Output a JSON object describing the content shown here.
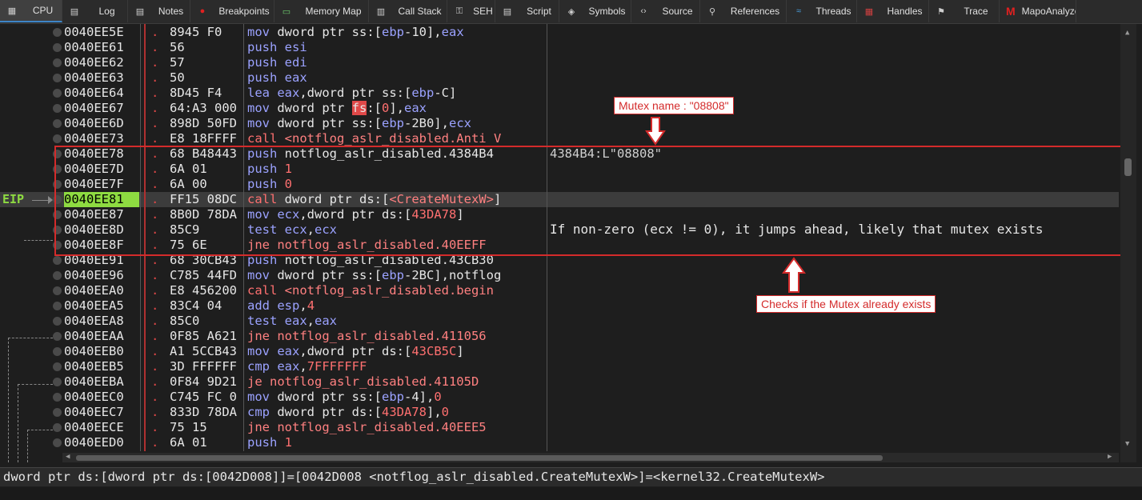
{
  "tabs": [
    {
      "label": "CPU",
      "icon": "cpu-icon",
      "active": true
    },
    {
      "label": "Log",
      "icon": "log-icon"
    },
    {
      "label": "Notes",
      "icon": "notes-icon"
    },
    {
      "label": "Breakpoints",
      "icon": "breakpoint-icon"
    },
    {
      "label": "Memory Map",
      "icon": "memory-map-icon"
    },
    {
      "label": "Call Stack",
      "icon": "call-stack-icon"
    },
    {
      "label": "SEH",
      "icon": "seh-icon"
    },
    {
      "label": "Script",
      "icon": "script-icon"
    },
    {
      "label": "Symbols",
      "icon": "symbols-icon"
    },
    {
      "label": "Source",
      "icon": "source-icon"
    },
    {
      "label": "References",
      "icon": "references-icon"
    },
    {
      "label": "Threads",
      "icon": "threads-icon"
    },
    {
      "label": "Handles",
      "icon": "handles-icon"
    },
    {
      "label": "Trace",
      "icon": "trace-icon"
    },
    {
      "label": "MapoAnalyzer",
      "icon": "mapoanalyzer-icon"
    }
  ],
  "eip_label": "EIP",
  "rows": [
    {
      "addr": "0040EE5E",
      "bytes": "8945 F0",
      "instr": "mov dword ptr ss:[ebp-10],eax",
      "comment": ""
    },
    {
      "addr": "0040EE61",
      "bytes": "56",
      "instr": "push esi",
      "comment": ""
    },
    {
      "addr": "0040EE62",
      "bytes": "57",
      "instr": "push edi",
      "comment": ""
    },
    {
      "addr": "0040EE63",
      "bytes": "50",
      "instr": "push eax",
      "comment": ""
    },
    {
      "addr": "0040EE64",
      "bytes": "8D45 F4",
      "instr": "lea eax,dword ptr ss:[ebp-C]",
      "comment": ""
    },
    {
      "addr": "0040EE67",
      "bytes": "64:A3 000",
      "instr": "mov dword ptr fs:[0],eax",
      "comment": ""
    },
    {
      "addr": "0040EE6D",
      "bytes": "898D 50FD",
      "instr": "mov dword ptr ss:[ebp-2B0],ecx",
      "comment": ""
    },
    {
      "addr": "0040EE73",
      "bytes": "E8 18FFFF",
      "instr": "call <notflog_aslr_disabled.Anti V",
      "comment": ""
    },
    {
      "addr": "0040EE78",
      "bytes": "68 B48443",
      "instr": "push notflog_aslr_disabled.4384B4",
      "comment": "4384B4:L\"08808\""
    },
    {
      "addr": "0040EE7D",
      "bytes": "6A 01",
      "instr": "push 1",
      "comment": ""
    },
    {
      "addr": "0040EE7F",
      "bytes": "6A 00",
      "instr": "push 0",
      "comment": ""
    },
    {
      "addr": "0040EE81",
      "bytes": "FF15 08DC",
      "instr": "call dword ptr ds:[<CreateMutexW>]",
      "comment": "",
      "eip": true
    },
    {
      "addr": "0040EE87",
      "bytes": "8B0D 78DA",
      "instr": "mov ecx,dword ptr ds:[43DA78]",
      "comment": ""
    },
    {
      "addr": "0040EE8D",
      "bytes": "85C9",
      "instr": "test ecx,ecx",
      "comment": ""
    },
    {
      "addr": "0040EE8F",
      "bytes": "75 6E",
      "instr": "jne notflog_aslr_disabled.40EEFF",
      "comment": ""
    },
    {
      "addr": "0040EE91",
      "bytes": "68 30CB43",
      "instr": "push notflog_aslr_disabled.43CB30",
      "comment": ""
    },
    {
      "addr": "0040EE96",
      "bytes": "C785 44FD",
      "instr": "mov dword ptr ss:[ebp-2BC],notflog",
      "comment": ""
    },
    {
      "addr": "0040EEA0",
      "bytes": "E8 456200",
      "instr": "call <notflog_aslr_disabled.begin",
      "comment": ""
    },
    {
      "addr": "0040EEA5",
      "bytes": "83C4 04",
      "instr": "add esp,4",
      "comment": ""
    },
    {
      "addr": "0040EEA8",
      "bytes": "85C0",
      "instr": "test eax,eax",
      "comment": ""
    },
    {
      "addr": "0040EEAA",
      "bytes": "0F85 A621",
      "instr": "jne notflog_aslr_disabled.411056",
      "comment": ""
    },
    {
      "addr": "0040EEB0",
      "bytes": "A1 5CCB43",
      "instr": "mov eax,dword ptr ds:[43CB5C]",
      "comment": ""
    },
    {
      "addr": "0040EEB5",
      "bytes": "3D FFFFFF",
      "instr": "cmp eax,7FFFFFFF",
      "comment": ""
    },
    {
      "addr": "0040EEBA",
      "bytes": "0F84 9D21",
      "instr": "je notflog_aslr_disabled.41105D",
      "comment": ""
    },
    {
      "addr": "0040EEC0",
      "bytes": "C745 FC 0",
      "instr": "mov dword ptr ss:[ebp-4],0",
      "comment": ""
    },
    {
      "addr": "0040EEC7",
      "bytes": "833D 78DA",
      "instr": "cmp dword ptr ds:[43DA78],0",
      "comment": ""
    },
    {
      "addr": "0040EECE",
      "bytes": "75 15",
      "instr": "jne notflog_aslr_disabled.40EEE5",
      "comment": ""
    },
    {
      "addr": "0040EED0",
      "bytes": "6A 01",
      "instr": "push 1",
      "comment": ""
    }
  ],
  "annotations": {
    "mutex_callout": "Mutex name : \"08808\"",
    "jump_note": "If non-zero (ecx != 0), it jumps ahead, likely that mutex exists",
    "checks_callout": "Checks if the Mutex already exists"
  },
  "info_bar": "dword ptr ds:[dword ptr ds:[0042D008]]=[0042D008 <notflog_aslr_disabled.CreateMutexW>]=<kernel32.CreateMutexW>",
  "colors": {
    "background": "#1e1e1e",
    "eip_highlight": "#8edb41",
    "annotation_red": "#d42b2b",
    "mnemonic_blue": "#9ba2ff",
    "call_red": "#ff7070"
  }
}
